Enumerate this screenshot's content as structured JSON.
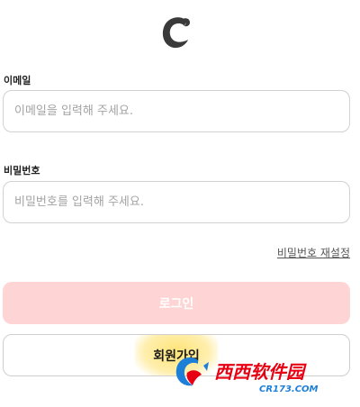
{
  "login": {
    "email_label": "이메일",
    "email_placeholder": "이메일을 입력해 주세요.",
    "password_label": "비밀번호",
    "password_placeholder": "비밀번호를 입력해 주세요.",
    "reset_password_link": "비밀번호 재설정",
    "login_button": "로그인",
    "signup_button": "회원가입"
  },
  "logo": {
    "icon": "brand-c-logo-icon"
  },
  "watermark": {
    "icon": "cr-logo-icon",
    "text_main": "西西软件园",
    "text_sub": "CR173.COM"
  },
  "colors": {
    "login_button_bg": "#ffd4d4",
    "signup_highlight": "#ffe26e",
    "watermark_red": "#e60012",
    "watermark_blue": "#1e7fd8"
  }
}
